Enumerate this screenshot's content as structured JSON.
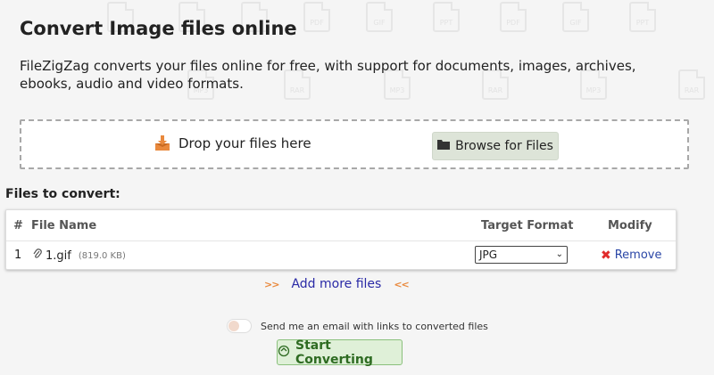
{
  "header": {
    "title": "Convert Image files online",
    "description": "FileZigZag converts your files online for free, with support for documents, images, archives, ebooks, audio and video formats."
  },
  "background_icons": [
    "PDF",
    "GIF",
    "PPT",
    "PDF",
    "GIF",
    "PPT",
    "MP3",
    "RAR",
    "MP3",
    "RAR",
    "MP3",
    "RAR"
  ],
  "drop_zone": {
    "label": "Drop your files here",
    "browse_label": "Browse for Files"
  },
  "files": {
    "heading": "Files to convert:",
    "columns": [
      "#",
      "File Name",
      "Target Format",
      "Modify"
    ],
    "rows": [
      {
        "index": "1",
        "name": "1.gif",
        "size": "(819.0 KB)",
        "format": "JPG",
        "action": "Remove"
      }
    ]
  },
  "add_more_label": "Add more files",
  "email_option": "Send me an email with links to converted files",
  "start_button": "Start Converting",
  "colors": {
    "accent_orange": "#e9893d",
    "link_blue": "#2a46a6",
    "start_green": "#2e6b22",
    "remove_red": "#e02b2b"
  }
}
